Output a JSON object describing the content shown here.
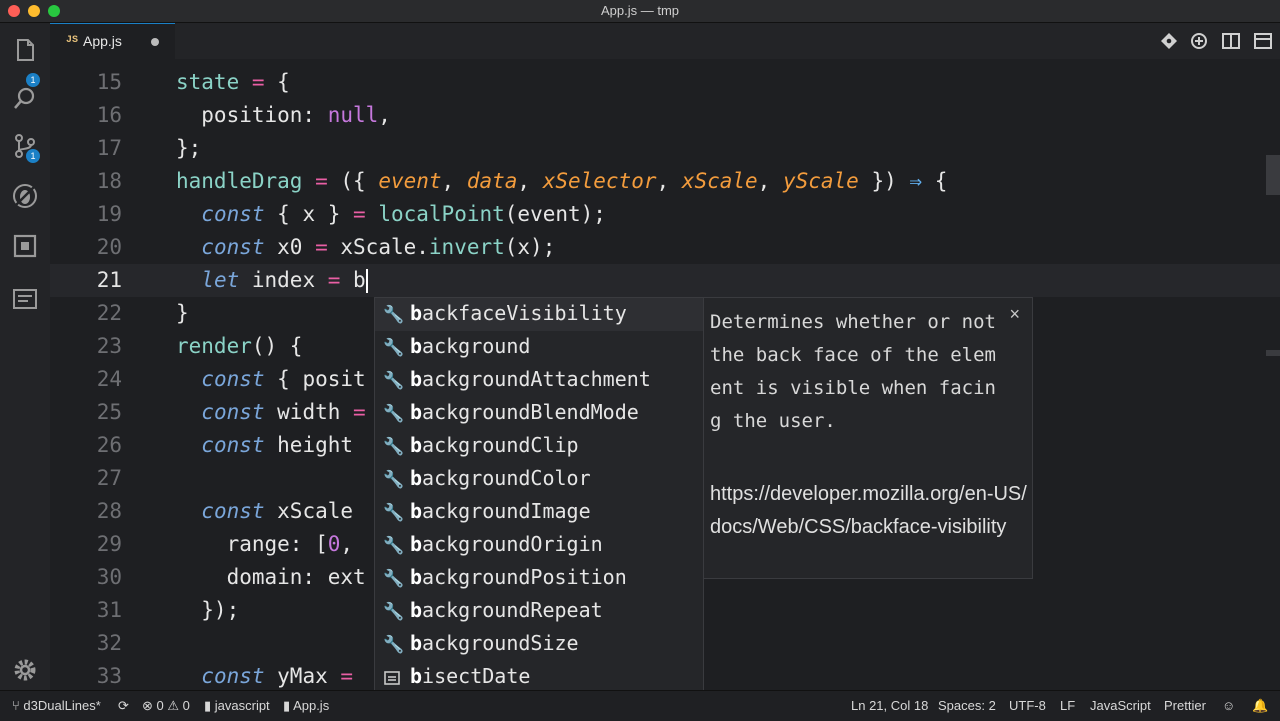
{
  "window": {
    "title": "App.js — tmp"
  },
  "activity": {
    "explorer_badge": "1",
    "scm_badge": "1"
  },
  "tabs": [
    {
      "icon_label": "JS",
      "label": "App.js"
    }
  ],
  "lines": [
    {
      "n": "15"
    },
    {
      "n": "16"
    },
    {
      "n": "17"
    },
    {
      "n": "18"
    },
    {
      "n": "19"
    },
    {
      "n": "20"
    },
    {
      "n": "21"
    },
    {
      "n": "22"
    },
    {
      "n": "23"
    },
    {
      "n": "24"
    },
    {
      "n": "25"
    },
    {
      "n": "26"
    },
    {
      "n": "27"
    },
    {
      "n": "28"
    },
    {
      "n": "29"
    },
    {
      "n": "30"
    },
    {
      "n": "31"
    },
    {
      "n": "32"
    },
    {
      "n": "33"
    }
  ],
  "code": {
    "l15": {
      "a": "state",
      "b": " = ",
      "c": "{"
    },
    "l16": {
      "a": "  position: ",
      "b": "null",
      "c": ","
    },
    "l17": {
      "a": "};"
    },
    "l18": {
      "a": "handleDrag",
      "b": " = ",
      "c": "({ ",
      "d": "event",
      "e": ", ",
      "f": "data",
      "g": ", ",
      "h": "xSelector",
      "i": ", ",
      "j": "xScale",
      "k": ", ",
      "l": "yScale",
      "m": " }) ",
      "n": "⇒",
      "o": " {"
    },
    "l19": {
      "a": "  ",
      "b": "const",
      "c": " { x } ",
      "d": "=",
      "e": " ",
      "f": "localPoint",
      "g": "(event);"
    },
    "l20": {
      "a": "  ",
      "b": "const",
      "c": " x0 ",
      "d": "=",
      "e": " xScale.",
      "f": "invert",
      "g": "(x);"
    },
    "l21": {
      "a": "  ",
      "b": "let",
      "c": " index ",
      "d": "=",
      "e": " b"
    },
    "l22": {
      "a": "}"
    },
    "l23": {
      "a": "render",
      "b": "() {"
    },
    "l24": {
      "a": "  ",
      "b": "const",
      "c": " { posit"
    },
    "l25": {
      "a": "  ",
      "b": "const",
      "c": " width ",
      "d": "="
    },
    "l26": {
      "a": "  ",
      "b": "const",
      "c": " height"
    },
    "l28": {
      "a": "  ",
      "b": "const",
      "c": " xScale"
    },
    "l29": {
      "a": "    range: [",
      "b": "0",
      "c": ","
    },
    "l30": {
      "a": "    domain: ext"
    },
    "l31": {
      "a": "  });"
    },
    "l33": {
      "a": "  ",
      "b": "const",
      "c": " yMax ",
      "d": "="
    }
  },
  "suggestions": [
    {
      "match": "b",
      "rest": "ackfaceVisibility",
      "icon": "wrench-icon"
    },
    {
      "match": "b",
      "rest": "ackground",
      "icon": "wrench-icon"
    },
    {
      "match": "b",
      "rest": "ackgroundAttachment",
      "icon": "wrench-icon"
    },
    {
      "match": "b",
      "rest": "ackgroundBlendMode",
      "icon": "wrench-icon"
    },
    {
      "match": "b",
      "rest": "ackgroundClip",
      "icon": "wrench-icon"
    },
    {
      "match": "b",
      "rest": "ackgroundColor",
      "icon": "wrench-icon"
    },
    {
      "match": "b",
      "rest": "ackgroundImage",
      "icon": "wrench-icon"
    },
    {
      "match": "b",
      "rest": "ackgroundOrigin",
      "icon": "wrench-icon"
    },
    {
      "match": "b",
      "rest": "ackgroundPosition",
      "icon": "wrench-icon"
    },
    {
      "match": "b",
      "rest": "ackgroundRepeat",
      "icon": "wrench-icon"
    },
    {
      "match": "b",
      "rest": "ackgroundSize",
      "icon": "wrench-icon"
    },
    {
      "match": "b",
      "rest": "isectDate",
      "icon": "variable-icon"
    }
  ],
  "docs": {
    "description": "Determines whether or not the back face of the element is visible when facing the user.",
    "link": "https://developer.mozilla.org/en-US/docs/Web/CSS/backface-visibility"
  },
  "status": {
    "branch": "d3DualLines*",
    "errors": "0",
    "warnings": "0",
    "language_badge": "javascript",
    "file": "App.js",
    "position": "Ln 21, Col 18",
    "spaces": "Spaces: 2",
    "encoding": "UTF-8",
    "eol": "LF",
    "language": "JavaScript",
    "formatter": "Prettier"
  }
}
